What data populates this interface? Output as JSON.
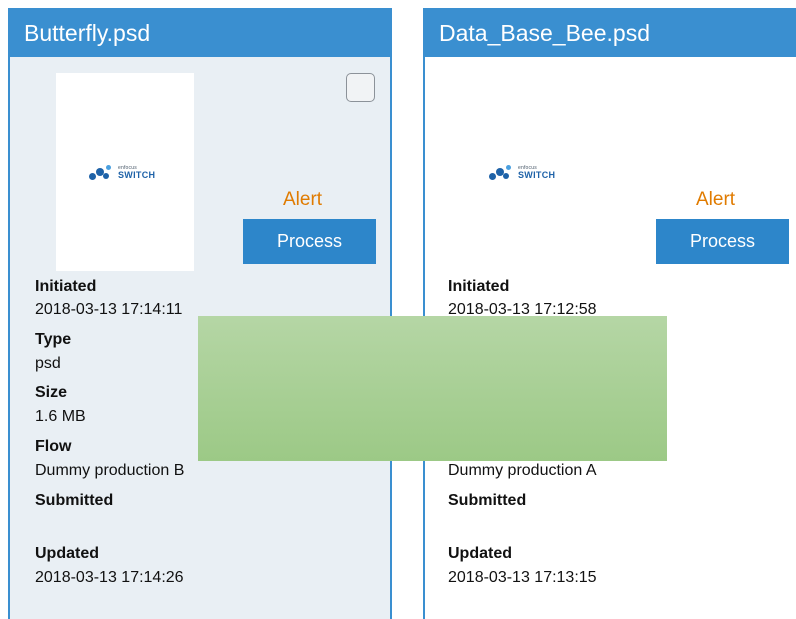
{
  "cards": [
    {
      "title": "Butterfly.psd",
      "logo": {
        "brand": "enfocus",
        "name": "SWITCH"
      },
      "alert": "Alert",
      "process_label": "Process",
      "fields": {
        "initiated_label": "Initiated",
        "initiated": "2018-03-13 17:14:11",
        "type_label": "Type",
        "type": "psd",
        "size_label": "Size",
        "size": "1.6 MB",
        "flow_label": "Flow",
        "flow": "Dummy production B",
        "submitted_label": "Submitted",
        "updated_label": "Updated",
        "updated": "2018-03-13 17:14:26"
      }
    },
    {
      "title": "Data_Base_Bee.psd",
      "logo": {
        "brand": "enfocus",
        "name": "SWITCH"
      },
      "alert": "Alert",
      "process_label": "Process",
      "fields": {
        "initiated_label": "Initiated",
        "initiated": "2018-03-13 17:12:58",
        "flow": "Dummy production A",
        "submitted_label": "Submitted",
        "updated_label": "Updated",
        "updated": "2018-03-13 17:13:15"
      }
    }
  ],
  "colors": {
    "header": "#3a8fd0",
    "button": "#2d86ca",
    "alert": "#e07b00",
    "overlay": "#a8cf95"
  }
}
